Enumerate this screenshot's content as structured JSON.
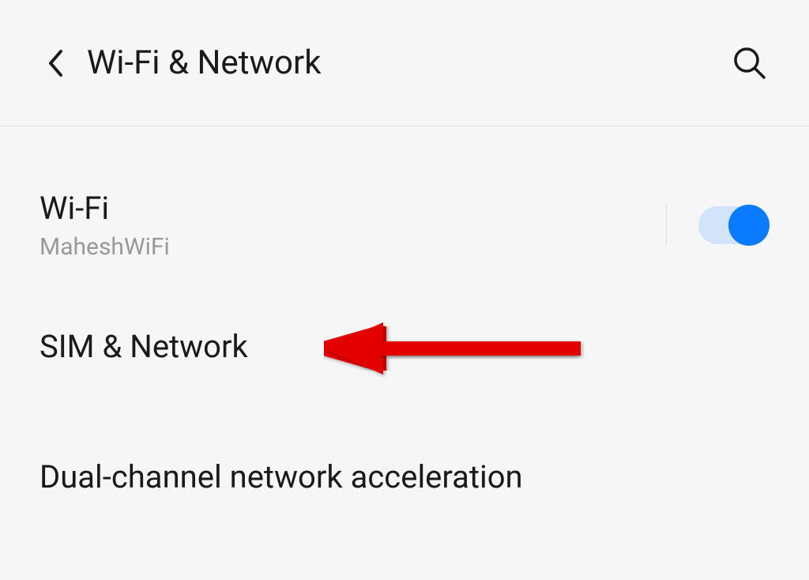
{
  "header": {
    "title": "Wi-Fi & Network"
  },
  "settings": {
    "wifi": {
      "label": "Wi-Fi",
      "sublabel": "MaheshWiFi",
      "enabled": true
    },
    "sim": {
      "label": "SIM & Network"
    },
    "dual": {
      "label": "Dual-channel network acceleration"
    }
  }
}
